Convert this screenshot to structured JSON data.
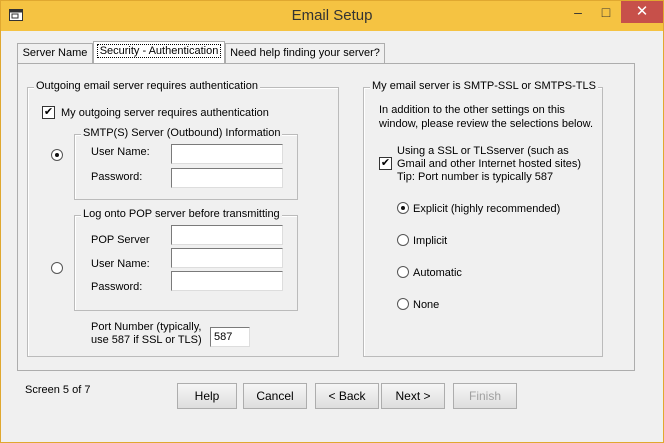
{
  "window": {
    "title": "Email Setup",
    "min_label": "–",
    "max_label": "□",
    "close_label": "✕"
  },
  "tabs": [
    {
      "label": "Server Name",
      "active": false
    },
    {
      "label": "Security - Authentication",
      "active": true
    },
    {
      "label": "Need help finding your server?",
      "active": false
    }
  ],
  "auth": {
    "group_title": "Outgoing email server requires authentication",
    "requires_auth_label": "My outgoing server requires authentication",
    "requires_auth_checked": true,
    "smtp_group": {
      "title": "SMTP(S) Server (Outbound) Information",
      "selected": true,
      "username_label": "User Name:",
      "username_value": "",
      "password_label": "Password:",
      "password_value": ""
    },
    "pop_group": {
      "title": "Log onto POP server before transmitting",
      "selected": false,
      "server_label": "POP Server",
      "server_value": "",
      "username_label": "User Name:",
      "username_value": "",
      "password_label": "Password:",
      "password_value": ""
    },
    "port_label_line1": "Port Number (typically,",
    "port_label_line2": "use 587 if SSL or TLS)",
    "port_value": "587"
  },
  "ssl": {
    "group_title": "My email server is SMTP-SSL or SMTPS-TLS",
    "intro_line1": "In addition to the other settings on this",
    "intro_line2": "window, please review the selections below.",
    "use_ssl_line1": "Using a SSL or TLSserver (such as",
    "use_ssl_line2": "Gmail and other Internet hosted sites)",
    "use_ssl_checked": true,
    "tip": "Tip: Port number is typically 587",
    "options": [
      {
        "label": "Explicit (highly recommended)",
        "selected": true
      },
      {
        "label": "Implicit",
        "selected": false
      },
      {
        "label": "Automatic",
        "selected": false
      },
      {
        "label": "None",
        "selected": false
      }
    ]
  },
  "footer": {
    "screen_status": "Screen 5 of 7",
    "help": "Help",
    "cancel": "Cancel",
    "back": "< Back",
    "next": "Next >",
    "finish": "Finish"
  }
}
